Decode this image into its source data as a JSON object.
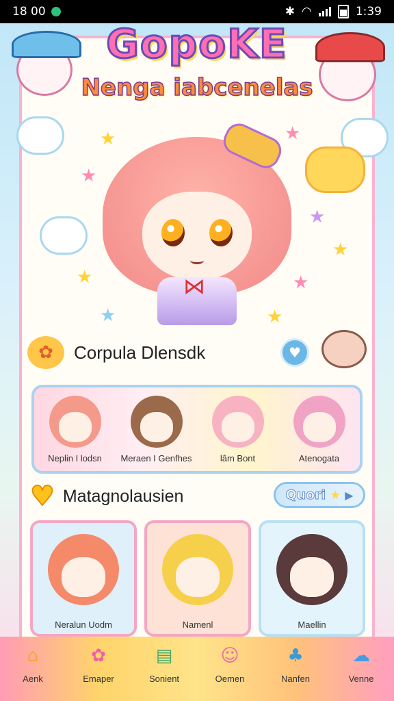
{
  "status": {
    "time_left": "18 00",
    "time_right": "1:39"
  },
  "header": {
    "title": "GopoKE",
    "subtitle": "Nenga iabcenelas"
  },
  "section_favorites": {
    "title": "Corpula Dlensdk"
  },
  "row_characters": [
    {
      "label": "Neplin I lodsn",
      "hair": "#f49a8a"
    },
    {
      "label": "Meraen I Genfhes",
      "hair": "#9a6a4a"
    },
    {
      "label": "lâm Bont",
      "hair": "#f7b3c2"
    },
    {
      "label": "Atenogata",
      "hair": "#f1a3c6"
    }
  ],
  "section_gallery": {
    "title": "Matagnolausien",
    "button_label": "Quori"
  },
  "cards": [
    {
      "label": "Neralun Uodm",
      "bg": "#dff0fb",
      "hair": "#f58a6a"
    },
    {
      "label": "Namenl",
      "bg": "#ffe2d6",
      "hair": "#f6d04a"
    },
    {
      "label": "Maellin",
      "bg": "#e4f4fc",
      "hair": "#5a3a3a"
    }
  ],
  "nav": [
    {
      "label": "Aenk",
      "icon": "house-icon",
      "glyph": "⌂",
      "color": "#f6a63a"
    },
    {
      "label": "Emaper",
      "icon": "blob-icon",
      "glyph": "✿",
      "color": "#ef5fa8"
    },
    {
      "label": "Sonient",
      "icon": "tablet-icon",
      "glyph": "▤",
      "color": "#4aa86a"
    },
    {
      "label": "Oemen",
      "icon": "smile-icon",
      "glyph": "☺",
      "color": "#ec6aa8"
    },
    {
      "label": "Nanfen",
      "icon": "cat-icon",
      "glyph": "♣",
      "color": "#3a9ad8"
    },
    {
      "label": "Venne",
      "icon": "cloud-icon",
      "glyph": "☁",
      "color": "#4a9ae0"
    }
  ]
}
